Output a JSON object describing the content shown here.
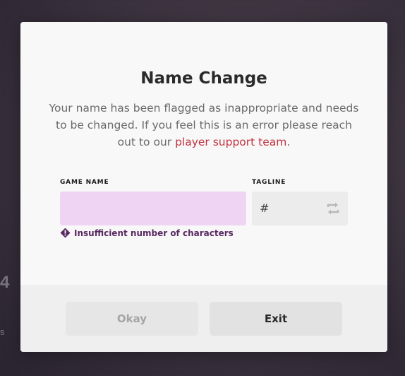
{
  "background": {
    "text_large": "4",
    "text_small": "s"
  },
  "dialog": {
    "title": "Name Change",
    "description_prefix": "Your name has been flagged as inappropriate and needs to be changed. If you feel this is an error please reach out to our ",
    "support_link": "player support team",
    "description_suffix": ".",
    "game_name_label": "GAME NAME",
    "game_name_value": "",
    "tagline_label": "TAGLINE",
    "tagline_prefix": "#",
    "tagline_value": "",
    "error_text": "Insufficient number of characters",
    "okay_label": "Okay",
    "exit_label": "Exit"
  },
  "colors": {
    "input_error_bg": "#efd5f3",
    "error_text": "#5a2a63",
    "link": "#c43241"
  }
}
